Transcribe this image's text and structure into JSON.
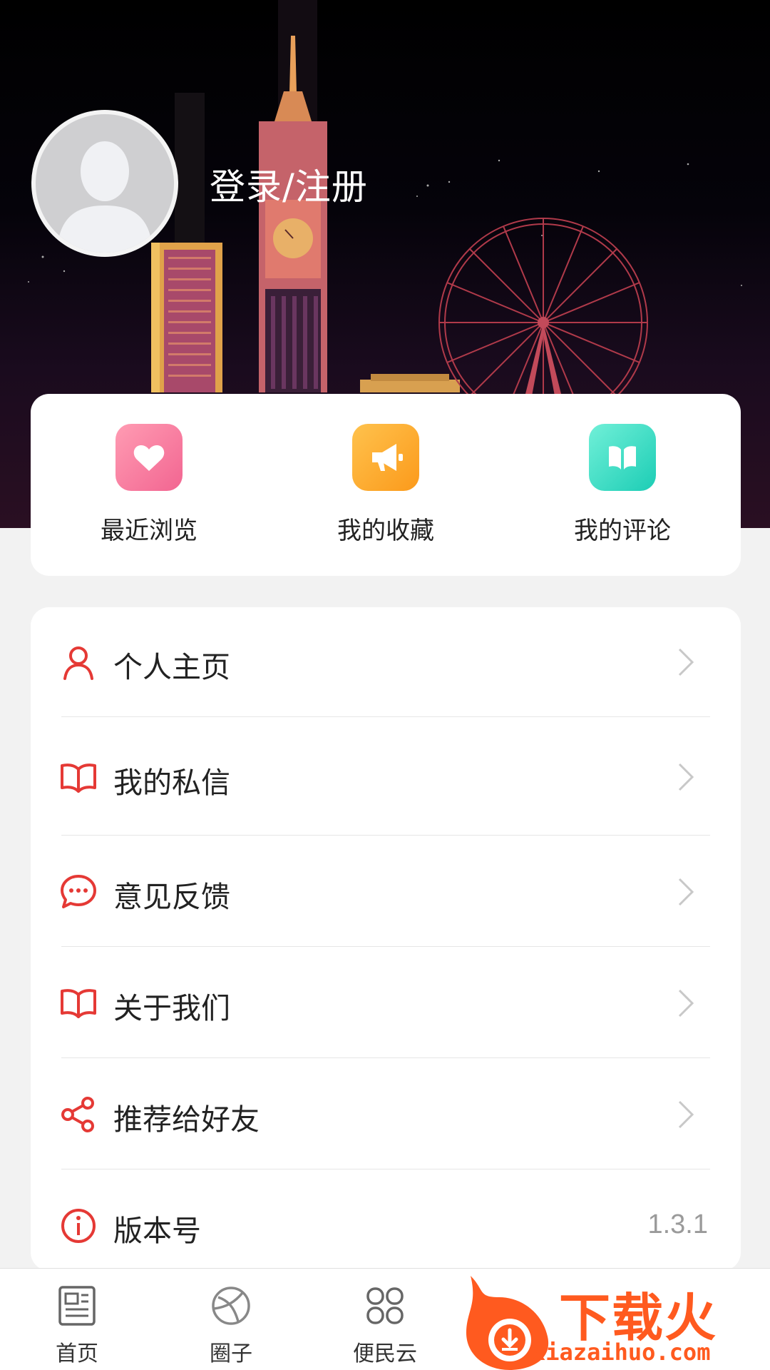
{
  "header": {
    "login_text": "登录/注册"
  },
  "quick_actions": [
    {
      "label": "最近浏览",
      "icon": "heart-icon",
      "color": "#f26591"
    },
    {
      "label": "我的收藏",
      "icon": "megaphone-icon",
      "color": "#fb9a1b"
    },
    {
      "label": "我的评论",
      "icon": "book-icon",
      "color": "#1ccdb5"
    }
  ],
  "menu": {
    "items": [
      {
        "label": "个人主页",
        "icon": "user-icon"
      },
      {
        "label": "我的私信",
        "icon": "book-open-icon"
      },
      {
        "label": "意见反馈",
        "icon": "chat-bubble-icon"
      },
      {
        "label": "关于我们",
        "icon": "book-open-icon"
      },
      {
        "label": "推荐给好友",
        "icon": "share-icon"
      },
      {
        "label": "版本号",
        "icon": "info-icon",
        "value": "1.3.1"
      }
    ],
    "icon_color": "#e53935"
  },
  "bottom_nav": {
    "items": [
      {
        "label": "首页",
        "icon": "newspaper-icon"
      },
      {
        "label": "圈子",
        "icon": "circle-play-icon"
      },
      {
        "label": "便民云",
        "icon": "clover-grid-icon"
      }
    ]
  },
  "watermark": {
    "text": "下载火",
    "url": "xiazaihuo.com",
    "color": "#ff5a1f"
  }
}
